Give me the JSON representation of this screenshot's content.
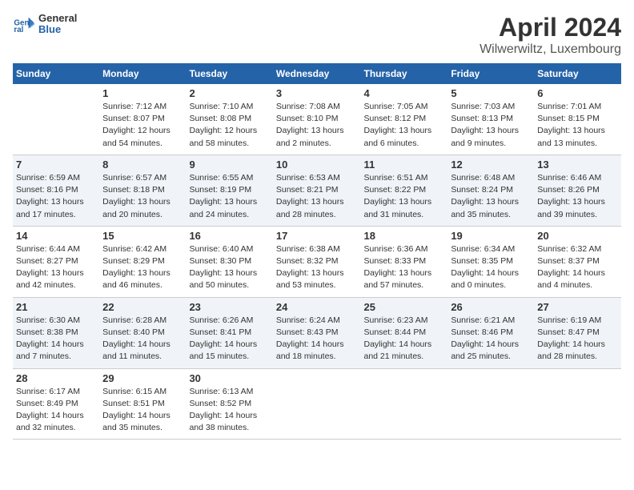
{
  "header": {
    "logo_line1": "General",
    "logo_line2": "Blue",
    "title": "April 2024",
    "subtitle": "Wilwerwiltz, Luxembourg"
  },
  "calendar": {
    "weekdays": [
      "Sunday",
      "Monday",
      "Tuesday",
      "Wednesday",
      "Thursday",
      "Friday",
      "Saturday"
    ],
    "weeks": [
      [
        {
          "day": "",
          "info": ""
        },
        {
          "day": "1",
          "info": "Sunrise: 7:12 AM\nSunset: 8:07 PM\nDaylight: 12 hours\nand 54 minutes."
        },
        {
          "day": "2",
          "info": "Sunrise: 7:10 AM\nSunset: 8:08 PM\nDaylight: 12 hours\nand 58 minutes."
        },
        {
          "day": "3",
          "info": "Sunrise: 7:08 AM\nSunset: 8:10 PM\nDaylight: 13 hours\nand 2 minutes."
        },
        {
          "day": "4",
          "info": "Sunrise: 7:05 AM\nSunset: 8:12 PM\nDaylight: 13 hours\nand 6 minutes."
        },
        {
          "day": "5",
          "info": "Sunrise: 7:03 AM\nSunset: 8:13 PM\nDaylight: 13 hours\nand 9 minutes."
        },
        {
          "day": "6",
          "info": "Sunrise: 7:01 AM\nSunset: 8:15 PM\nDaylight: 13 hours\nand 13 minutes."
        }
      ],
      [
        {
          "day": "7",
          "info": "Sunrise: 6:59 AM\nSunset: 8:16 PM\nDaylight: 13 hours\nand 17 minutes."
        },
        {
          "day": "8",
          "info": "Sunrise: 6:57 AM\nSunset: 8:18 PM\nDaylight: 13 hours\nand 20 minutes."
        },
        {
          "day": "9",
          "info": "Sunrise: 6:55 AM\nSunset: 8:19 PM\nDaylight: 13 hours\nand 24 minutes."
        },
        {
          "day": "10",
          "info": "Sunrise: 6:53 AM\nSunset: 8:21 PM\nDaylight: 13 hours\nand 28 minutes."
        },
        {
          "day": "11",
          "info": "Sunrise: 6:51 AM\nSunset: 8:22 PM\nDaylight: 13 hours\nand 31 minutes."
        },
        {
          "day": "12",
          "info": "Sunrise: 6:48 AM\nSunset: 8:24 PM\nDaylight: 13 hours\nand 35 minutes."
        },
        {
          "day": "13",
          "info": "Sunrise: 6:46 AM\nSunset: 8:26 PM\nDaylight: 13 hours\nand 39 minutes."
        }
      ],
      [
        {
          "day": "14",
          "info": "Sunrise: 6:44 AM\nSunset: 8:27 PM\nDaylight: 13 hours\nand 42 minutes."
        },
        {
          "day": "15",
          "info": "Sunrise: 6:42 AM\nSunset: 8:29 PM\nDaylight: 13 hours\nand 46 minutes."
        },
        {
          "day": "16",
          "info": "Sunrise: 6:40 AM\nSunset: 8:30 PM\nDaylight: 13 hours\nand 50 minutes."
        },
        {
          "day": "17",
          "info": "Sunrise: 6:38 AM\nSunset: 8:32 PM\nDaylight: 13 hours\nand 53 minutes."
        },
        {
          "day": "18",
          "info": "Sunrise: 6:36 AM\nSunset: 8:33 PM\nDaylight: 13 hours\nand 57 minutes."
        },
        {
          "day": "19",
          "info": "Sunrise: 6:34 AM\nSunset: 8:35 PM\nDaylight: 14 hours\nand 0 minutes."
        },
        {
          "day": "20",
          "info": "Sunrise: 6:32 AM\nSunset: 8:37 PM\nDaylight: 14 hours\nand 4 minutes."
        }
      ],
      [
        {
          "day": "21",
          "info": "Sunrise: 6:30 AM\nSunset: 8:38 PM\nDaylight: 14 hours\nand 7 minutes."
        },
        {
          "day": "22",
          "info": "Sunrise: 6:28 AM\nSunset: 8:40 PM\nDaylight: 14 hours\nand 11 minutes."
        },
        {
          "day": "23",
          "info": "Sunrise: 6:26 AM\nSunset: 8:41 PM\nDaylight: 14 hours\nand 15 minutes."
        },
        {
          "day": "24",
          "info": "Sunrise: 6:24 AM\nSunset: 8:43 PM\nDaylight: 14 hours\nand 18 minutes."
        },
        {
          "day": "25",
          "info": "Sunrise: 6:23 AM\nSunset: 8:44 PM\nDaylight: 14 hours\nand 21 minutes."
        },
        {
          "day": "26",
          "info": "Sunrise: 6:21 AM\nSunset: 8:46 PM\nDaylight: 14 hours\nand 25 minutes."
        },
        {
          "day": "27",
          "info": "Sunrise: 6:19 AM\nSunset: 8:47 PM\nDaylight: 14 hours\nand 28 minutes."
        }
      ],
      [
        {
          "day": "28",
          "info": "Sunrise: 6:17 AM\nSunset: 8:49 PM\nDaylight: 14 hours\nand 32 minutes."
        },
        {
          "day": "29",
          "info": "Sunrise: 6:15 AM\nSunset: 8:51 PM\nDaylight: 14 hours\nand 35 minutes."
        },
        {
          "day": "30",
          "info": "Sunrise: 6:13 AM\nSunset: 8:52 PM\nDaylight: 14 hours\nand 38 minutes."
        },
        {
          "day": "",
          "info": ""
        },
        {
          "day": "",
          "info": ""
        },
        {
          "day": "",
          "info": ""
        },
        {
          "day": "",
          "info": ""
        }
      ]
    ]
  }
}
